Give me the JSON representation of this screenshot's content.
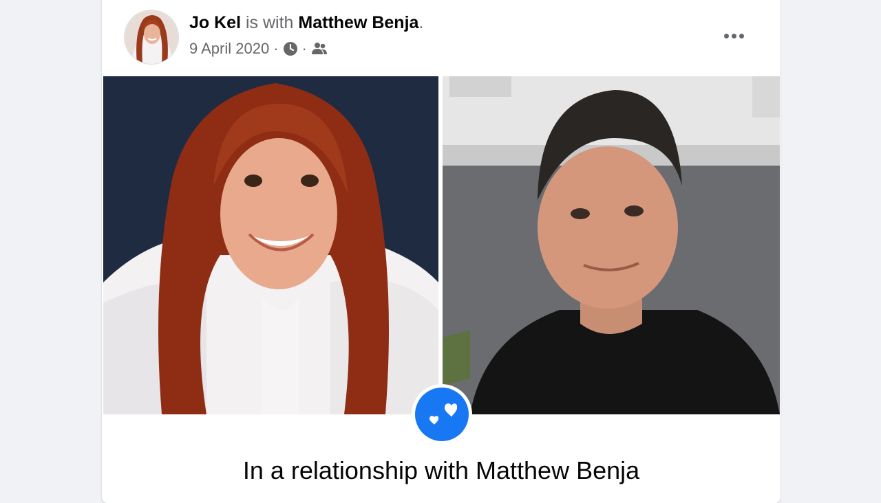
{
  "post": {
    "author_name": "Jo Kel",
    "connector": " is with ",
    "tagged_name": "Matthew Benja",
    "title_end": ".",
    "date": "9 April 2020",
    "separator": "·",
    "time_icon": "clock-icon",
    "audience_icon": "friends-icon",
    "more_icon": "more-options-icon",
    "relationship_text": "In a relationship with Matthew Benja",
    "badge_icon": "hearts-icon"
  },
  "colors": {
    "accent": "#1877f2",
    "background": "#f0f2f5",
    "card": "#ffffff",
    "text_primary": "#050505",
    "text_secondary": "#65676b"
  }
}
